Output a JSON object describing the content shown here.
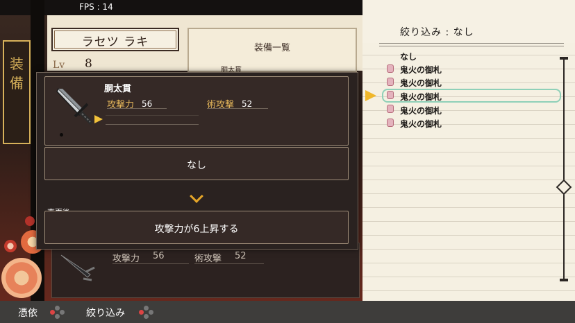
{
  "hud": {
    "fps": "FPS : 14"
  },
  "character": {
    "name": "ラセツ ラキ",
    "level_label": "Lv",
    "level": "8"
  },
  "menu_tab": {
    "label": "装\n備"
  },
  "equipment_list": {
    "title": "装備一覧",
    "first_item": "胴太貫"
  },
  "modal": {
    "item_name": "胴太貫",
    "attack_label": "攻撃力",
    "attack_value": "56",
    "magic_label": "術攻撃",
    "magic_value": "52",
    "slot_value": "なし",
    "after_label": "変更後",
    "after_text": "攻撃力が6上昇する"
  },
  "ghost_stats": {
    "attack_label": "攻撃力",
    "attack_value": "56",
    "magic_label": "術攻撃",
    "magic_value": "52"
  },
  "filter": {
    "title": "絞り込み : なし",
    "items": [
      "なし",
      "鬼火の御札",
      "鬼火の御札",
      "鬼火の御札",
      "鬼火の御札",
      "鬼火の御札"
    ],
    "selected_index": 3
  },
  "controls": {
    "possess_label": "憑依",
    "filter_label": "絞り込み"
  },
  "colors": {
    "accent_gold": "#e3b55a",
    "selection_teal": "#8fd0b8",
    "cursor_yellow": "#f0b72a"
  }
}
